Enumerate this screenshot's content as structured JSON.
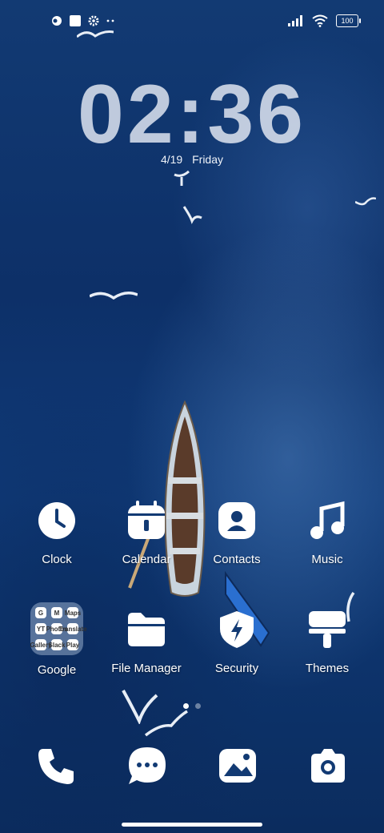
{
  "status_bar": {
    "battery": "100",
    "icons": [
      "notification-icon",
      "square-icon",
      "gear-icon",
      "overflow-icon",
      "signal-icon",
      "wifi-icon",
      "battery-icon"
    ]
  },
  "lock_clock": {
    "time": "02:36",
    "date": "4/19",
    "weekday": "Friday"
  },
  "apps_row1": [
    {
      "label": "Clock",
      "icon": "clock-icon"
    },
    {
      "label": "Calendar",
      "icon": "calendar-icon"
    },
    {
      "label": "Contacts",
      "icon": "contacts-icon"
    },
    {
      "label": "Music",
      "icon": "music-icon"
    }
  ],
  "apps_row2": [
    {
      "label": "Google",
      "icon": "folder-icon"
    },
    {
      "label": "File Manager",
      "icon": "folder-file-icon"
    },
    {
      "label": "Security",
      "icon": "shield-bolt-icon"
    },
    {
      "label": "Themes",
      "icon": "paint-roller-icon"
    }
  ],
  "google_folder_apps": [
    "G",
    "M",
    "Maps",
    "YT",
    "Photos",
    "Translate",
    "Gallery",
    "Slack",
    "Play"
  ],
  "dock": [
    "phone-icon",
    "messages-icon",
    "gallery-icon",
    "camera-icon"
  ],
  "colors": {
    "background": "#0f3a78"
  }
}
